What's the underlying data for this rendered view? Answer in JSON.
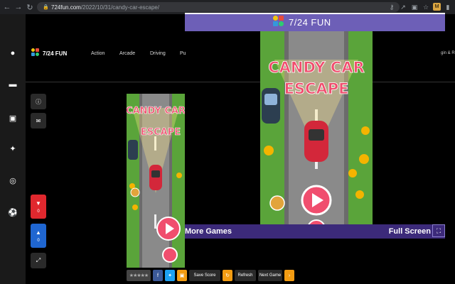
{
  "browser": {
    "url_host": "724fun.com",
    "url_path": "/2022/10/31/candy-car-escape/",
    "extension_label": "M"
  },
  "site": {
    "logo_text": "7/24 FUN",
    "menu": [
      "Action",
      "Arcade",
      "Driving",
      "Pu"
    ],
    "right_fragment": "gin & R"
  },
  "rail_icons": [
    "bomb-icon",
    "gamepad-icon",
    "car-icon",
    "puzzle-icon",
    "target-icon",
    "soccer-ball-icon"
  ],
  "side": {
    "info_icon": "i",
    "comment_icon": "comment",
    "dislike_count": "0",
    "like_count": "0"
  },
  "game": {
    "title_line1": "CANDY CAR",
    "title_line2": "ESCAPE"
  },
  "toolbar": {
    "save_score": "Save Score",
    "refresh": "Refresh",
    "next_game": "Next Game"
  },
  "popup": {
    "title": "7/24 FUN",
    "more_games": "More Games",
    "full_screen": "Full Screen"
  },
  "colors": {
    "popup_bar": "#6d5fb7",
    "popup_bottom": "#3c2a7a",
    "dislike": "#e0282e",
    "like": "#1f66d1",
    "facebook": "#3b5998",
    "twitter": "#1da1f2",
    "orange": "#f39c12"
  }
}
